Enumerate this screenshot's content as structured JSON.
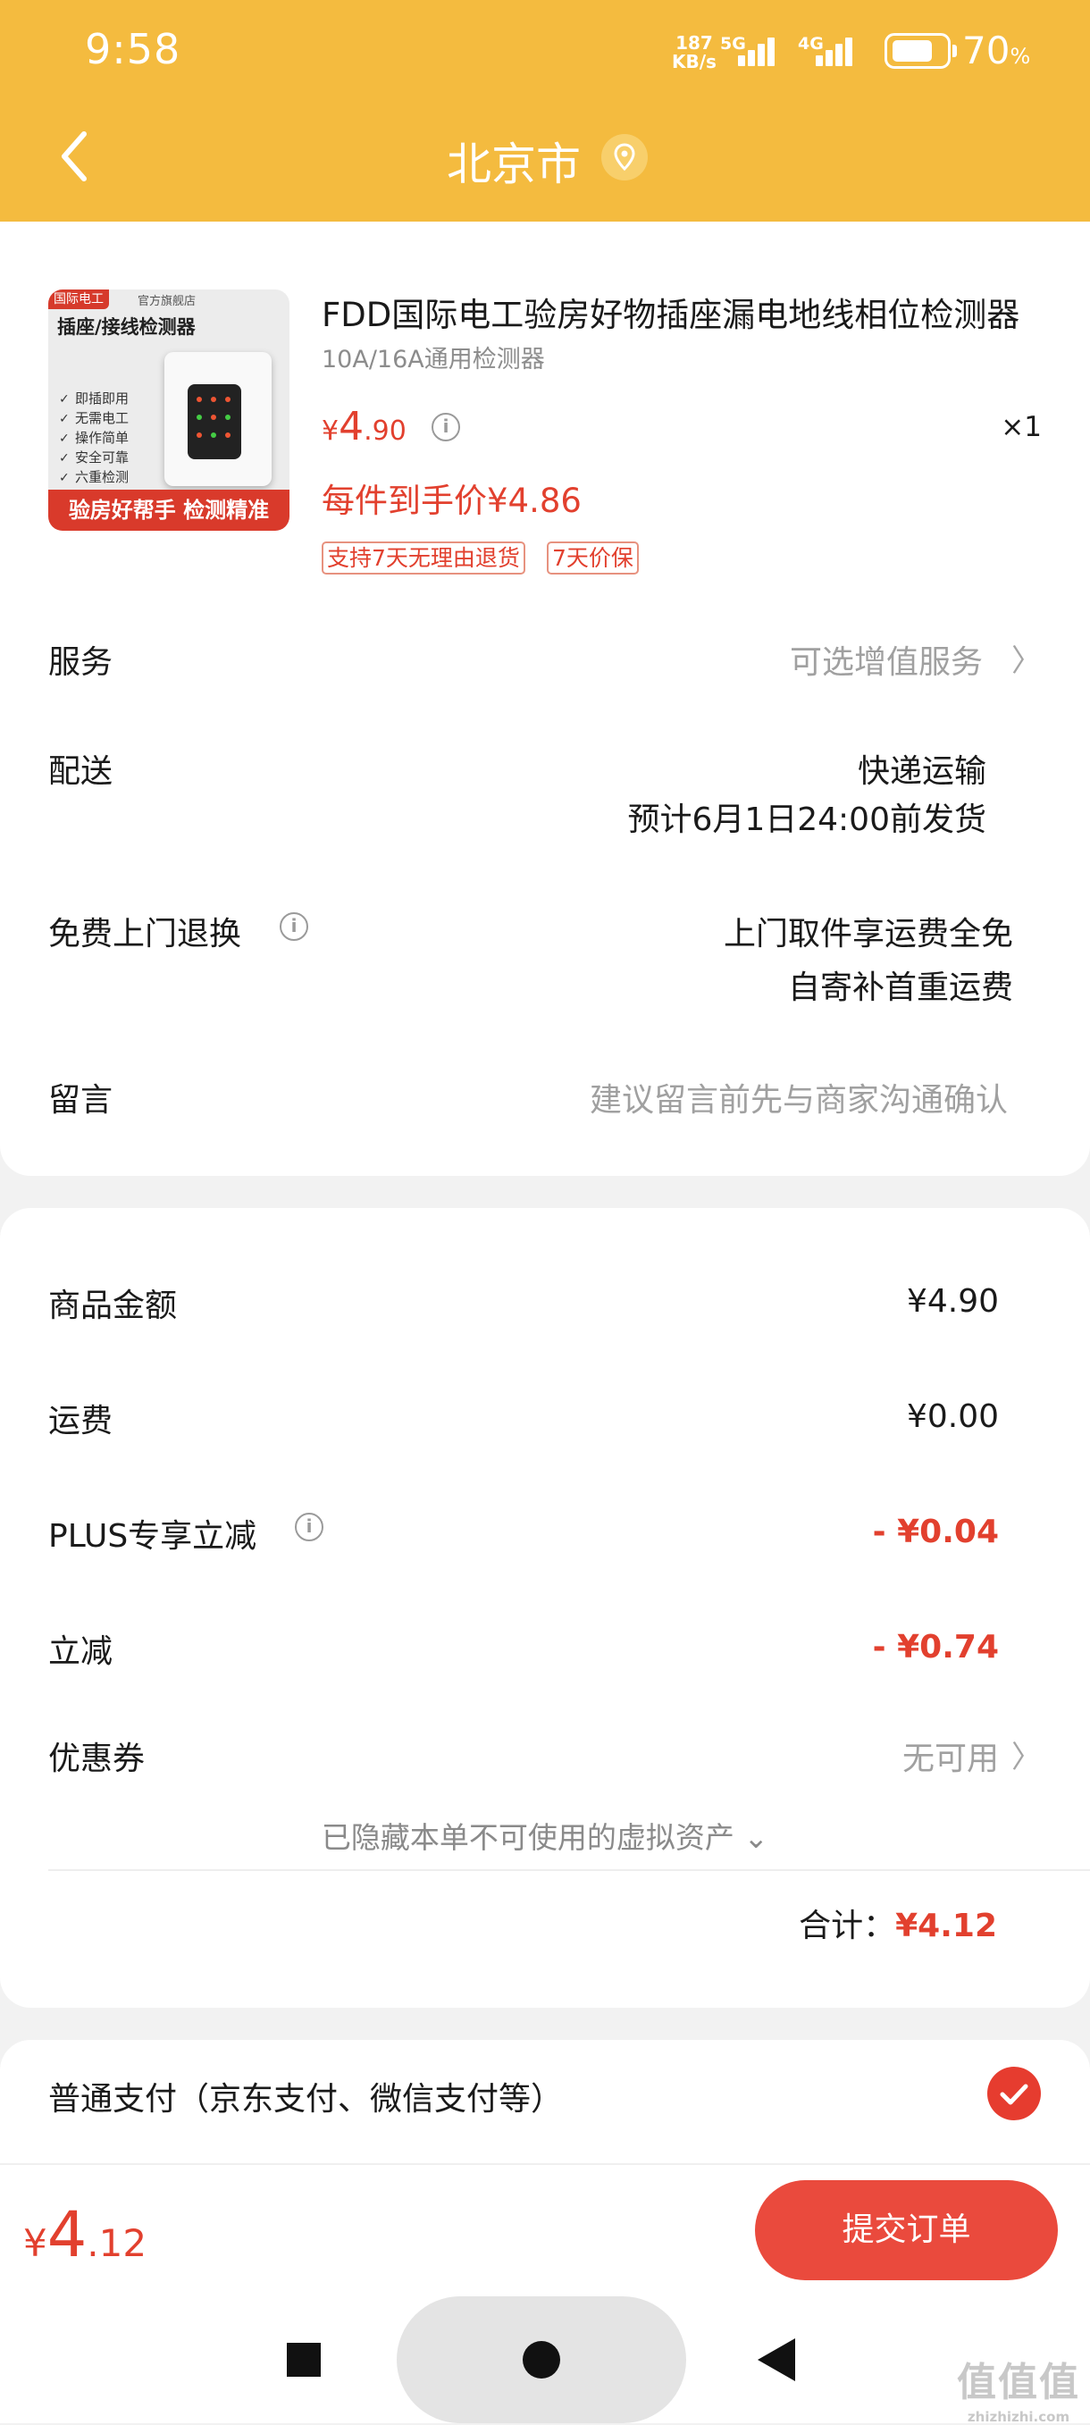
{
  "status_bar": {
    "time": "9:58",
    "net_speed_value": "187",
    "net_speed_unit": "KB/s",
    "sig1_gen": "5G",
    "sig2_gen": "4G",
    "battery_level": "70",
    "battery_pct": "%"
  },
  "nav": {
    "title": "北京市"
  },
  "product": {
    "title": "FDD国际电工验房好物插座漏电地线相位检测器",
    "spec": "10A/16A通用检测器",
    "price_symbol": "¥",
    "price_int": "4",
    "price_dec": ".90",
    "qty": "×1",
    "final_price": "每件到手价¥4.86",
    "tags": [
      "支持7天无理由退货",
      "7天价保"
    ],
    "thumb": {
      "badge": "国际电工",
      "badge2": "官方旗舰店",
      "title": "插座/接线检测器",
      "features": [
        "即插即用",
        "无需电工",
        "操作简单",
        "安全可靠",
        "六重检测"
      ],
      "footer": "验房好帮手 检测精准"
    }
  },
  "rows": {
    "service": {
      "label": "服务",
      "value": "可选增值服务"
    },
    "delivery": {
      "label": "配送",
      "value1": "快递运输",
      "value2": "预计6月1日24:00前发货"
    },
    "free_return": {
      "label": "免费上门退换",
      "value1": "上门取件享运费全免",
      "value2": "自寄补首重运费"
    },
    "message": {
      "label": "留言",
      "placeholder": "建议留言前先与商家沟通确认"
    }
  },
  "summary": {
    "goods_label": "商品金额",
    "goods_value": "¥4.90",
    "shipping_label": "运费",
    "shipping_value": "¥0.00",
    "plus_label": "PLUS专享立减",
    "plus_value": "- ¥0.04",
    "discount_label": "立减",
    "discount_value": "- ¥0.74",
    "coupon_label": "优惠券",
    "coupon_value": "无可用",
    "hidden_assets": "已隐藏本单不可使用的虚拟资产",
    "total_label": "合计：",
    "total_value": "¥4.12"
  },
  "payment": {
    "label": "普通支付（京东支付、微信支付等）"
  },
  "bottom": {
    "price_symbol": "¥",
    "price_int": "4",
    "price_dec": ".12",
    "submit": "提交订单"
  },
  "watermark": {
    "glyphs": "值值值",
    "site": "zhizhizhi.com"
  },
  "colors": {
    "header": "#f4bb3f",
    "accent": "#e2402e",
    "button": "#ea4a3d"
  }
}
